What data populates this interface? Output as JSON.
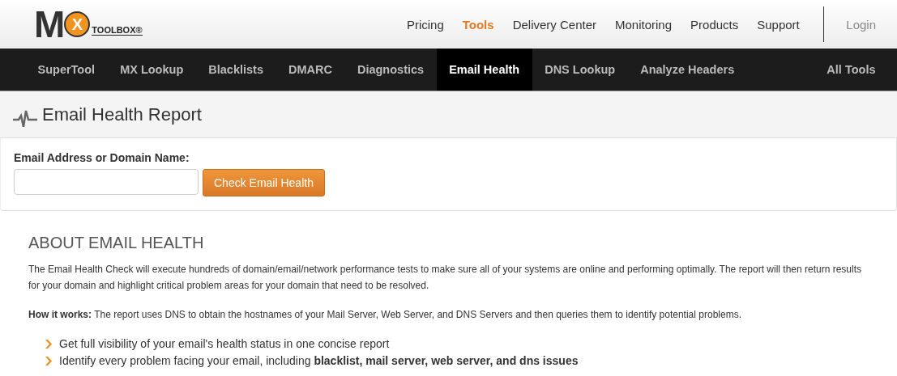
{
  "logo": {
    "big_letter": "M",
    "circle_letter": "X",
    "wordmark": "TOOLBOX®"
  },
  "top_nav": [
    {
      "label": "Pricing",
      "selected": false
    },
    {
      "label": "Tools",
      "selected": true
    },
    {
      "label": "Delivery Center",
      "selected": false
    },
    {
      "label": "Monitoring",
      "selected": false
    },
    {
      "label": "Products",
      "selected": false
    },
    {
      "label": "Support",
      "selected": false
    }
  ],
  "login": "Login",
  "tool_nav": [
    {
      "label": "SuperTool",
      "selected": false
    },
    {
      "label": "MX Lookup",
      "selected": false
    },
    {
      "label": "Blacklists",
      "selected": false
    },
    {
      "label": "DMARC",
      "selected": false
    },
    {
      "label": "Diagnostics",
      "selected": false
    },
    {
      "label": "Email Health",
      "selected": true
    },
    {
      "label": "DNS Lookup",
      "selected": false
    },
    {
      "label": "Analyze Headers",
      "selected": false
    }
  ],
  "all_tools": "All Tools",
  "page_title": "Email Health Report",
  "form": {
    "label": "Email Address or Domain Name:",
    "button": "Check Email Health"
  },
  "about": {
    "heading": "ABOUT EMAIL HEALTH",
    "paragraphs": [
      "The Email Health Check will execute hundreds of domain/email/network performance tests to make sure all of your systems are online and performing optimally. The report will then return results for your domain and highlight critical problem areas for your domain that need to be resolved.",
      "**How it works:** The report uses DNS to obtain the hostnames of your Mail Server, Web Server, and DNS Servers and then queries them to identify potential problems."
    ],
    "bullets": [
      "Get full visibility of your email's health status in one concise report",
      "Identify every problem facing your email, including **blacklist, mail server, web server, and dns issues**"
    ]
  }
}
